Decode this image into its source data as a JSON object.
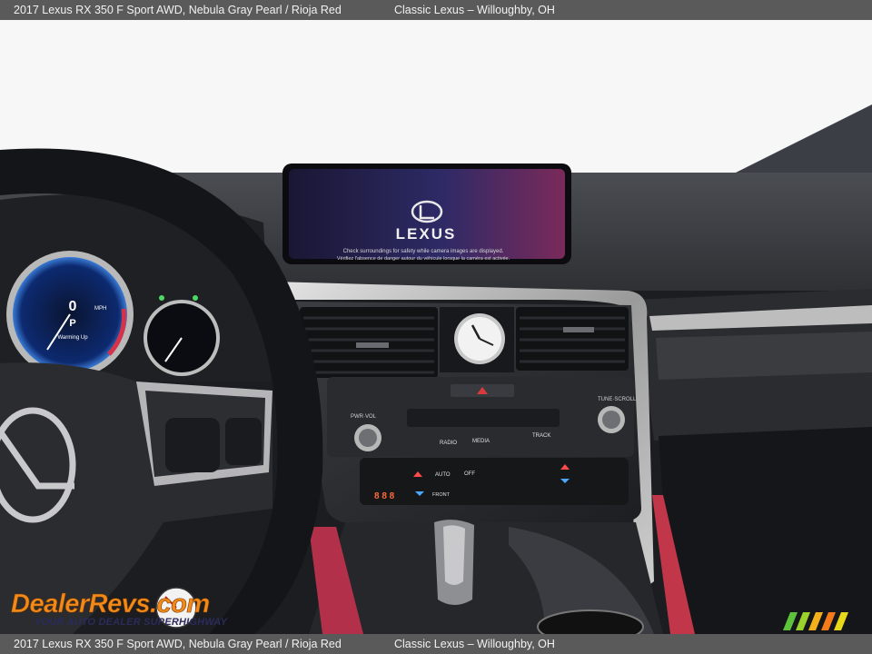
{
  "caption": {
    "car": "2017 Lexus RX 350 F Sport AWD,  Nebula Gray Pearl / Rioja Red",
    "dealer": "Classic Lexus – Willoughby, OH"
  },
  "screen": {
    "brand": "LEXUS",
    "notice_en": "Check surroundings for safety while camera images are displayed.",
    "notice_fr": "Vérifiez l'absence de danger autour du véhicule lorsque la caméra est activée."
  },
  "cluster": {
    "speed": "0",
    "speed_unit": "MPH",
    "gear": "P",
    "status": "Warming Up"
  },
  "controls": {
    "pwr_vol": "PWR·VOL",
    "tune_scroll": "TUNE·SCROLL",
    "radio": "RADIO",
    "media": "MEDIA",
    "track": "TRACK",
    "auto": "AUTO",
    "off": "OFF",
    "front": "FRONT",
    "temp_left": "8 8 8"
  },
  "watermark": {
    "logo_text": "DealerRevs.com",
    "tagline": "YOUR AUTO DEALER SUPERHIGHWAY"
  },
  "colors": {
    "caption_bar": "#5a5a5a",
    "interior_red": "#c2364a",
    "dash_dark": "#2a2b2e"
  }
}
